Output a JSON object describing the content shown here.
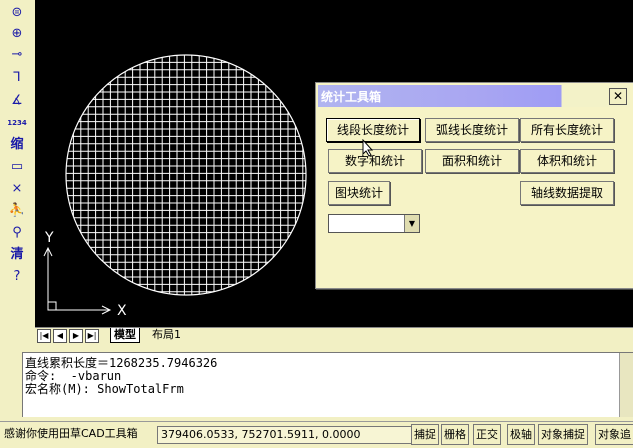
{
  "toolbar": {
    "tools": [
      {
        "icon": "stamp-icon",
        "glyph": "⊜"
      },
      {
        "icon": "crosshair-icon",
        "glyph": "⊕"
      },
      {
        "icon": "break-line-icon",
        "glyph": "⊸"
      },
      {
        "icon": "hook-icon",
        "glyph": "⅂"
      },
      {
        "icon": "angle-dimension-icon",
        "glyph": "∡"
      },
      {
        "icon": "renumber-icon",
        "text": "1234"
      },
      {
        "icon": "scale-icon",
        "text": "缩"
      },
      {
        "icon": "window-icon",
        "glyph": "▭"
      },
      {
        "icon": "trim-icon",
        "glyph": "⨯"
      },
      {
        "icon": "person-icon",
        "glyph": "⛹"
      },
      {
        "icon": "zoom-icon",
        "glyph": "⚲"
      },
      {
        "icon": "clear-icon",
        "text": "清"
      },
      {
        "icon": "help-icon",
        "glyph": "?"
      }
    ]
  },
  "canvas": {
    "axis_y_label": "Y",
    "axis_x_label": "X"
  },
  "tabs": {
    "active": "模型",
    "layout": "布局1"
  },
  "dialog": {
    "title": "统计工具箱",
    "close_label": "✕",
    "buttons": {
      "line_length": "线段长度统计",
      "arc_length": "弧线长度统计",
      "all_length": "所有长度统计",
      "number_sum": "数字和统计",
      "area_sum": "面积和统计",
      "volume_sum": "体积和统计",
      "block_count": "图块统计",
      "axis_extract": "轴线数据提取"
    },
    "combo_value": ""
  },
  "command": {
    "lines": [
      "直线累积长度＝1268235.7946326",
      "命令:  -vbarun",
      "宏名称(M): ShowTotalFrm"
    ]
  },
  "status": {
    "welcome": "感谢你使用田草CAD工具箱",
    "coords": "379406.0533, 752701.5911, 0.0000",
    "buttons": [
      "捕捉",
      "栅格",
      "正交",
      "极轴",
      "对象捕捉",
      "对象追"
    ]
  },
  "colors": {
    "canvas_bg": "#000000",
    "drawing_stroke": "#ffffff",
    "panel_bg": "#f2f0c4",
    "icon_blue": "#1a1aa8"
  }
}
